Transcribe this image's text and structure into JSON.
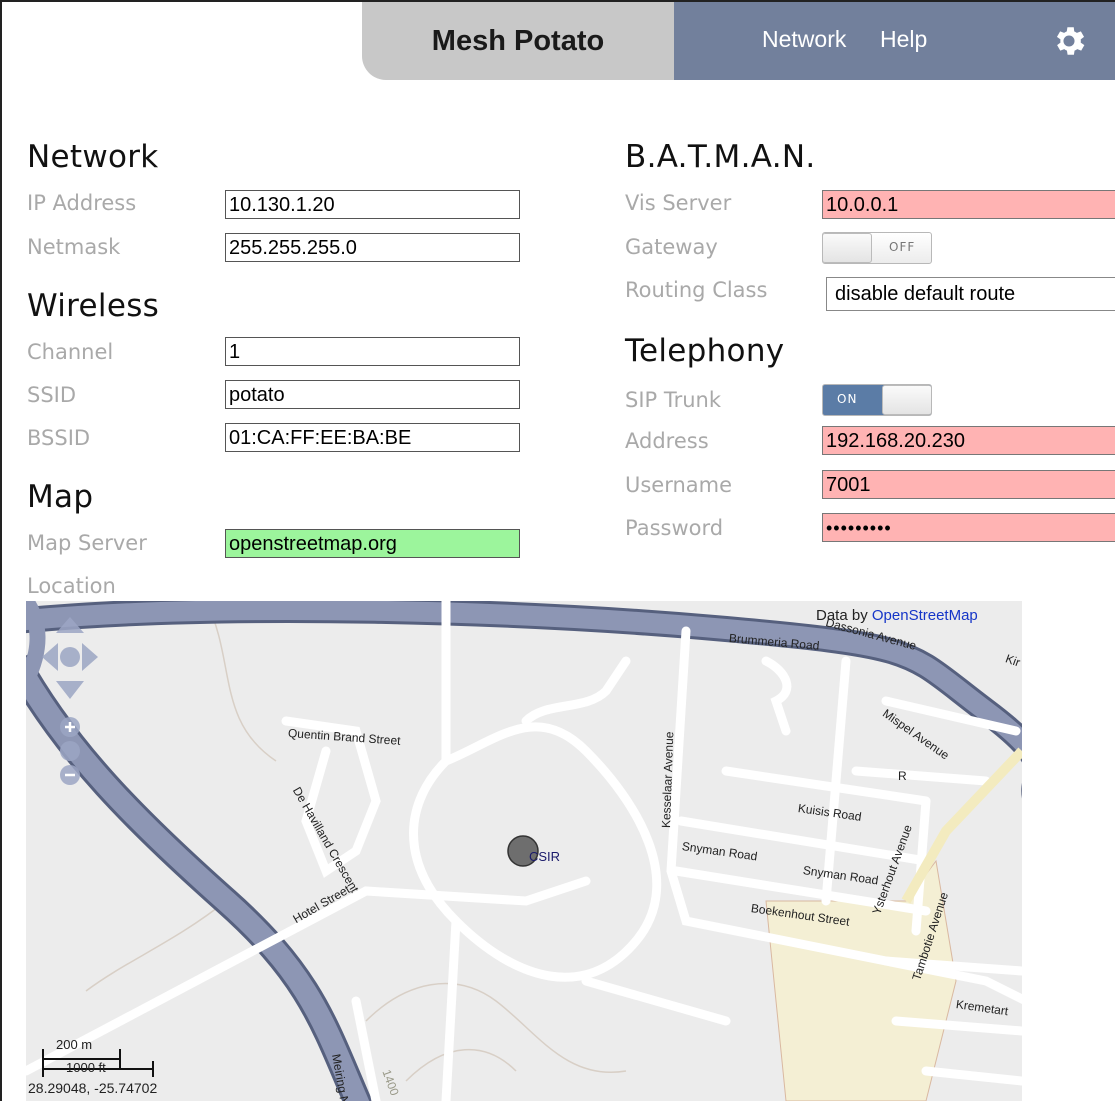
{
  "header": {
    "title": "Mesh Potato",
    "nav": [
      "Network",
      "Help"
    ],
    "settings_icon": "gear-icon"
  },
  "network": {
    "title": "Network",
    "ip_label": "IP Address",
    "ip_value": "10.130.1.20",
    "netmask_label": "Netmask",
    "netmask_value": "255.255.255.0"
  },
  "wireless": {
    "title": "Wireless",
    "channel_label": "Channel",
    "channel_value": "1",
    "ssid_label": "SSID",
    "ssid_value": "potato",
    "bssid_label": "BSSID",
    "bssid_value": "01:CA:FF:EE:BA:BE"
  },
  "map_section": {
    "title": "Map",
    "server_label": "Map Server",
    "server_value": "openstreetmap.org",
    "location_label": "Location"
  },
  "batman": {
    "title": "B.A.T.M.A.N.",
    "vis_label": "Vis Server",
    "vis_value": "10.0.0.1",
    "gateway_label": "Gateway",
    "gateway_state": "OFF",
    "routing_label": "Routing Class",
    "routing_value": "disable default route"
  },
  "telephony": {
    "title": "Telephony",
    "sip_label": "SIP Trunk",
    "sip_state": "ON",
    "address_label": "Address",
    "address_value": "192.168.20.230",
    "username_label": "Username",
    "username_value": "7001",
    "password_label": "Password",
    "password_value": "•••••••••"
  },
  "map": {
    "attribution_prefix": "Data by",
    "attribution_link": "OpenStreetMap",
    "scale_metric": "200 m",
    "scale_imperial": "1000 ft",
    "coordinates": "28.29048, -25.74702",
    "marker_label": "CSIR",
    "streets": {
      "brummeria": "Brummeria Road",
      "dassonia": "Dassonia Avenue",
      "kir": "Kir",
      "mispel": "Mispel Avenue",
      "quentin": "Quentin Brand Street",
      "dehavilland": "De Havilland Crescent",
      "kesselaar": "Kesselaar Avenue",
      "r": "R",
      "kulsis": "Kuisis Road",
      "snyman1": "Snyman Road",
      "snyman2": "Snyman Road",
      "boekenhout": "Boekenhout Street",
      "ysterhout": "Ysterhout Avenue",
      "tambotie": "Tambotie Avenue",
      "kremetart": "Kremetart",
      "hotel": "Hotel Street",
      "meiring": "Meiring Naude",
      "contour": "1400"
    },
    "colors": {
      "highway": "#8d96b4",
      "highway_edge": "#56607e",
      "road": "#ffffff",
      "background": "#ececec",
      "area": "#f4efd4"
    }
  }
}
